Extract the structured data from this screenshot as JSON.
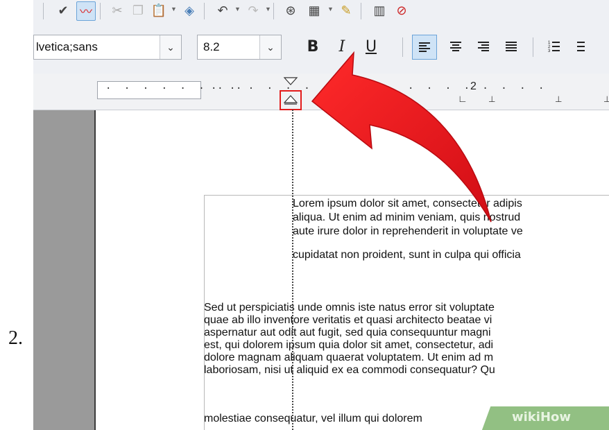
{
  "step_number": "2.",
  "toolbar": {
    "font_name": "lvetica;sans",
    "font_size": "8.2",
    "bold_label": "B",
    "italic_label": "I",
    "underline_label": "U"
  },
  "ruler": {
    "left_dots": "· · · · · · · ·",
    "mid_dots": "· · · · · · · · · ·",
    "right_dots": "· · · · · · · ·",
    "number": "2"
  },
  "document": {
    "para1": [
      "Lorem ipsum dolor sit amet, consectetur adipis",
      "aliqua. Ut enim ad minim veniam, quis nostrud",
      "aute irure dolor in reprehenderit in voluptate ve",
      "cupidatat non proident, sunt in culpa qui officia"
    ],
    "para2": [
      "Sed ut perspiciatis unde omnis iste natus error sit voluptate",
      "quae ab illo inventore veritatis et quasi architecto beatae vi",
      "aspernatur aut odit aut fugit, sed quia consequuntur magni",
      "est, qui dolorem ipsum quia dolor sit amet, consectetur, adi",
      "dolore magnam aliquam quaerat voluptatem. Ut enim ad m",
      "laboriosam, nisi ut aliquid ex ea commodi consequatur? Qu",
      "molestiae consequatur, vel illum qui dolorem"
    ]
  },
  "watermark": "wikiHow",
  "colors": {
    "arrow": "#e8121a",
    "highlight_box": "#e31b1b",
    "active_button": "#cfe3f6"
  },
  "icons": [
    "spellcheck-icon",
    "autospell-icon",
    "cut-icon",
    "copy-icon",
    "paste-icon",
    "clone-icon",
    "undo-icon",
    "redo-icon",
    "navigator-icon",
    "table-icon",
    "draw-icon",
    "columns-icon",
    "record-icon",
    "paragraph-spacing-icon"
  ]
}
